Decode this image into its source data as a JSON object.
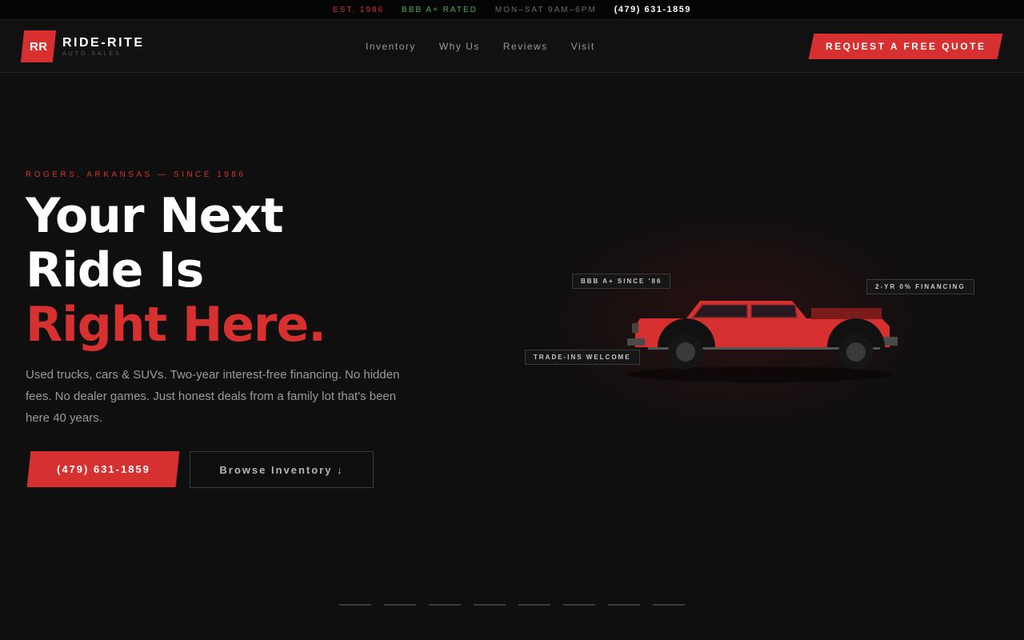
{
  "topbar": {
    "est": "EST. 1986",
    "bbb": "BBB A+ RATED",
    "hours": "MON–SAT 9AM–6PM",
    "phone": "(479) 631-1859"
  },
  "brand": {
    "badge": "RR",
    "name": "RIDE-RITE",
    "sub": "AUTO SALES"
  },
  "nav": {
    "links": [
      "Inventory",
      "Why Us",
      "Reviews",
      "Visit"
    ],
    "quote_label": "REQUEST A FREE QUOTE"
  },
  "hero": {
    "eyebrow": "ROGERS, ARKANSAS — SINCE 1986",
    "line1": "Your Next",
    "line2": "Ride Is",
    "line3": "Right Here.",
    "description": "Used trucks, cars & SUVs. Two-year interest-free financing. No hidden fees. No dealer games. Just honest deals from a family lot that's been here 40 years.",
    "phone_cta": "(479) 631-1859",
    "browse_cta": "Browse Inventory ↓"
  },
  "tags": {
    "bbb": "BBB A+ SINCE '86",
    "financing": "2-YR 0% FINANCING",
    "trade": "TRADE-INS WELCOME"
  },
  "colors": {
    "accent": "#d63031",
    "background": "#0f0f10",
    "bbb_green": "#4caf50"
  },
  "carousel": {
    "slide_count": 8
  }
}
